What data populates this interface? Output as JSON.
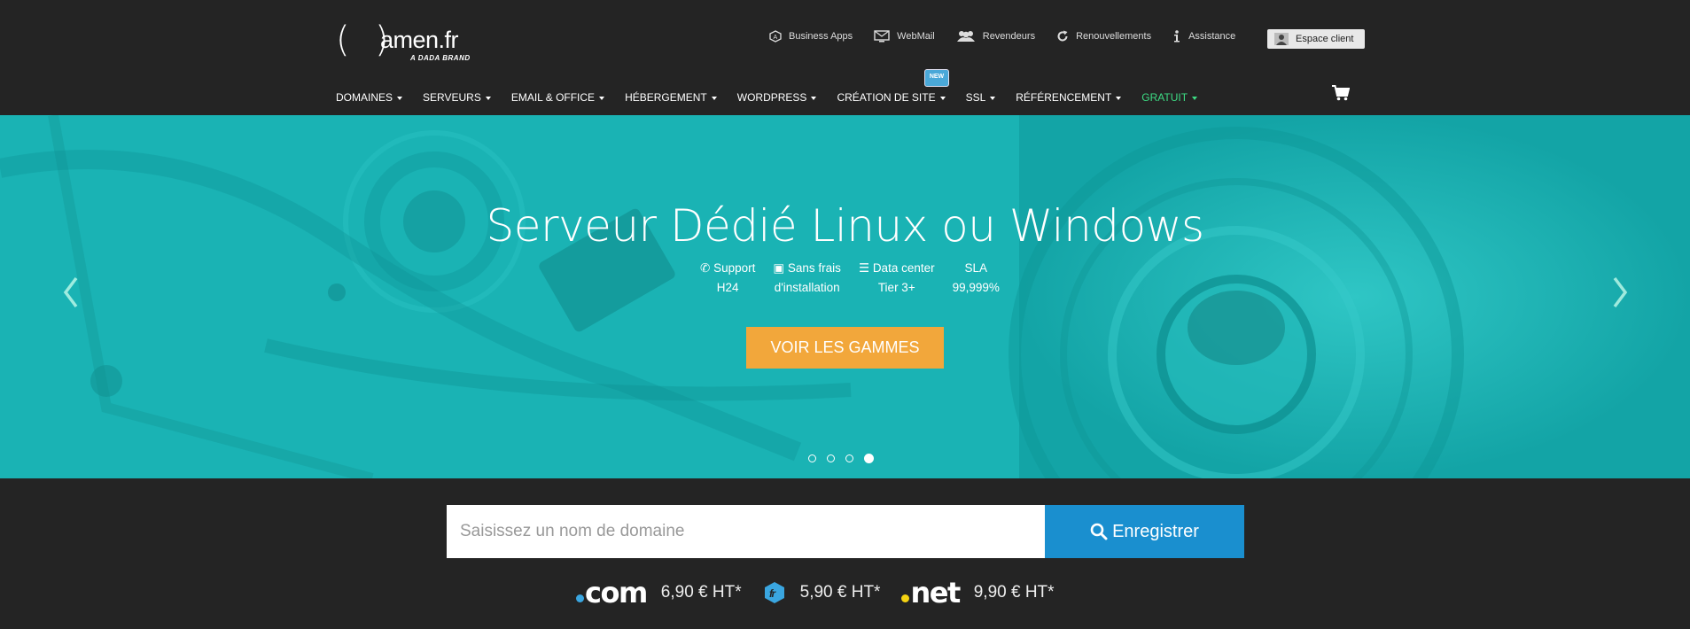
{
  "logo": {
    "word": "amen.fr",
    "parens": "( )",
    "brand": "A DADA BRAND"
  },
  "toplinks": [
    {
      "label": "Business Apps",
      "icon": "apps-icon"
    },
    {
      "label": "WebMail",
      "icon": "monitor-icon"
    },
    {
      "label": "Revendeurs",
      "icon": "users-icon"
    },
    {
      "label": "Renouvellements",
      "icon": "refresh-icon"
    },
    {
      "label": "Assistance",
      "icon": "info-icon"
    }
  ],
  "espace_client": "Espace client",
  "nav": [
    {
      "label": "DOMAINES"
    },
    {
      "label": "SERVEURS"
    },
    {
      "label": "EMAIL & OFFICE"
    },
    {
      "label": "HÉBERGEMENT"
    },
    {
      "label": "WORDPRESS"
    },
    {
      "label": "CRÉATION DE SITE"
    },
    {
      "label": "SSL"
    },
    {
      "label": "RÉFÉRENCEMENT"
    },
    {
      "label": "GRATUIT"
    }
  ],
  "new_badge": "NEW",
  "hero": {
    "title": "Serveur Dédié Linux ou Windows",
    "features": [
      {
        "line1": "Support",
        "line2": "H24"
      },
      {
        "line1": "Sans frais",
        "line2": "d'installation"
      },
      {
        "line1": "Data center",
        "line2": "Tier 3+"
      },
      {
        "line1": "SLA",
        "line2": "99,999%"
      }
    ],
    "cta": "VOIR LES GAMMES",
    "slides": 4,
    "active_slide": 4
  },
  "search": {
    "placeholder": "Saisissez un nom de domaine",
    "button": "Enregistrer"
  },
  "prices": [
    {
      "tld": ".com",
      "price": "6,90 € HT*"
    },
    {
      "tld": ".fr",
      "price": "5,90 € HT*"
    },
    {
      "tld": ".net",
      "price": "9,90 € HT*"
    }
  ],
  "colors": {
    "accent_green": "#3ddc84",
    "hero_teal": "#1ab3b4",
    "cta_orange": "#f2a73b",
    "search_blue": "#1a8fcf"
  }
}
